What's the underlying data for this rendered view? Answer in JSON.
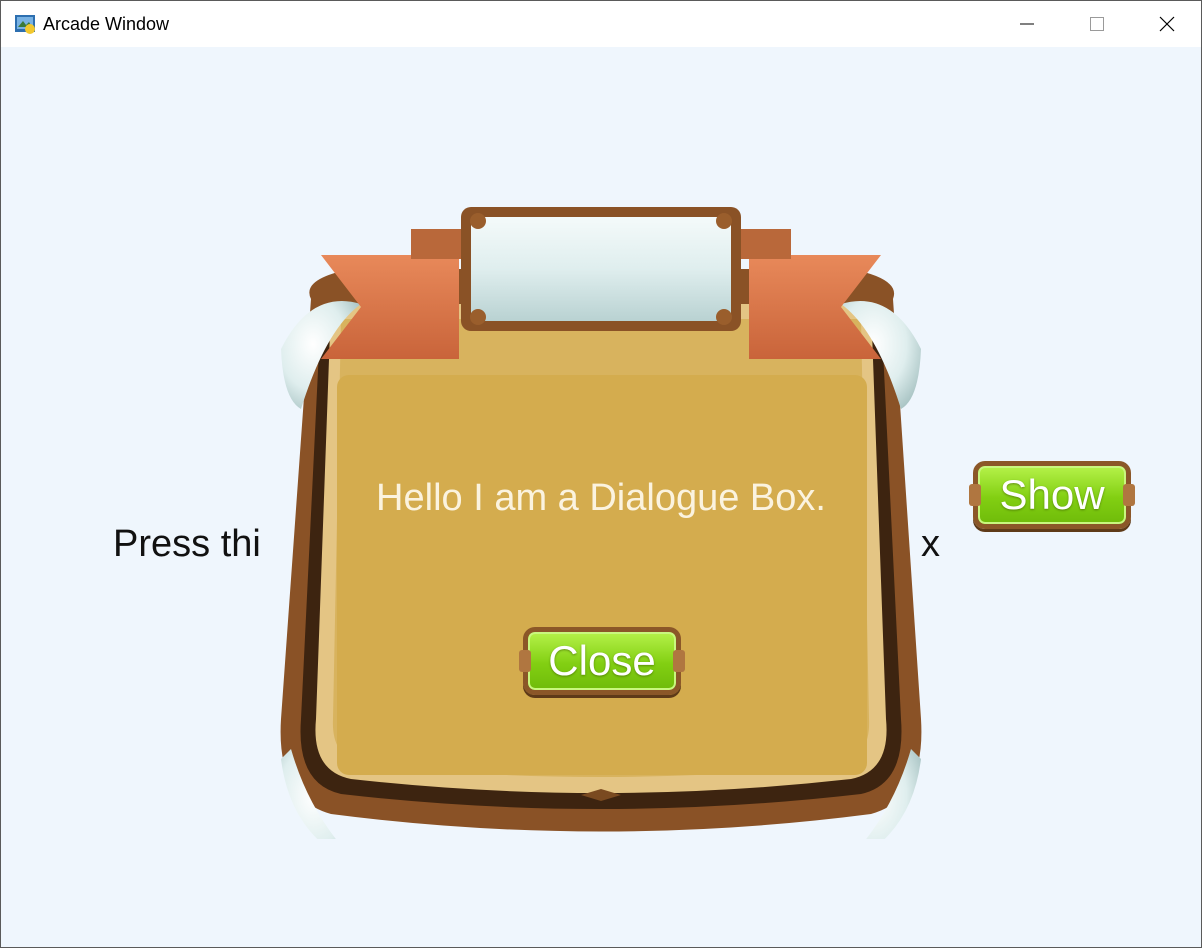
{
  "window": {
    "title": "Arcade Window",
    "controls": [
      "minimize",
      "maximize",
      "close"
    ]
  },
  "scene": {
    "background_color": "#eff6fd",
    "prompt_visible_start": "Press thi",
    "prompt_visible_end": "x",
    "show_button_label": "Show"
  },
  "dialog": {
    "message": "Hello I am a Dialogue Box.",
    "close_button_label": "Close",
    "panel_color": "#d4ac4e",
    "ribbon_color": "#d9774a",
    "button_color": "#8fd81a"
  }
}
